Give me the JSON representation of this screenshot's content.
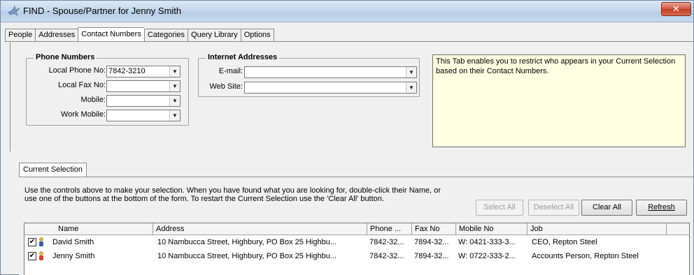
{
  "window": {
    "title": "FIND - Spouse/Partner for Jenny Smith",
    "close_label": "✕"
  },
  "tabs": [
    {
      "label": "People"
    },
    {
      "label": "Addresses"
    },
    {
      "label": "Contact Numbers"
    },
    {
      "label": "Categories"
    },
    {
      "label": "Query Library"
    },
    {
      "label": "Options"
    }
  ],
  "phone_numbers": {
    "title": "Phone Numbers",
    "fields": [
      {
        "label": "Local Phone No:",
        "value": "7842-3210"
      },
      {
        "label": "Local Fax No:",
        "value": ""
      },
      {
        "label": "Mobile:",
        "value": ""
      },
      {
        "label": "Work Mobile:",
        "value": ""
      }
    ]
  },
  "internet_addresses": {
    "title": "Internet Addresses",
    "fields": [
      {
        "label": "E-mail:",
        "value": ""
      },
      {
        "label": "Web Site:",
        "value": ""
      }
    ]
  },
  "info_text": "This Tab enables you to restrict who appears in your Current Selection based on their Contact Numbers.",
  "current_selection": {
    "tab_label": "Current Selection",
    "instructions": "Use the controls above to make your selection.  When you have found what you are looking for, double-click their Name, or use one of the buttons at the bottom of the form.  To restart the Current Selection use the 'Clear All' button.",
    "buttons": {
      "select_all": "Select All",
      "deselect_all": "Deselect All",
      "clear_all": "Clear All",
      "refresh": "Refresh"
    },
    "columns": [
      "Name",
      "Address",
      "Phone ...",
      "Fax No",
      "Mobile No",
      "Job"
    ],
    "rows": [
      {
        "checked": true,
        "name": "David Smith",
        "address": "10 Nambucca Street, Highbury, PO Box 25 Highbu...",
        "phone": "7842-32...",
        "fax": "7894-32...",
        "mobile": "W: 0421-333-3...",
        "job": "CEO, Repton Steel",
        "icon_color": "#3a5fa8"
      },
      {
        "checked": true,
        "name": "Jenny Smith",
        "address": "10 Nambucca Street, Highbury, PO Box 25 Highbu...",
        "phone": "7842-32...",
        "fax": "7894-32...",
        "mobile": "W: 0722-333-2...",
        "job": "Accounts Person, Repton Steel",
        "icon_color": "#d94030"
      }
    ]
  }
}
